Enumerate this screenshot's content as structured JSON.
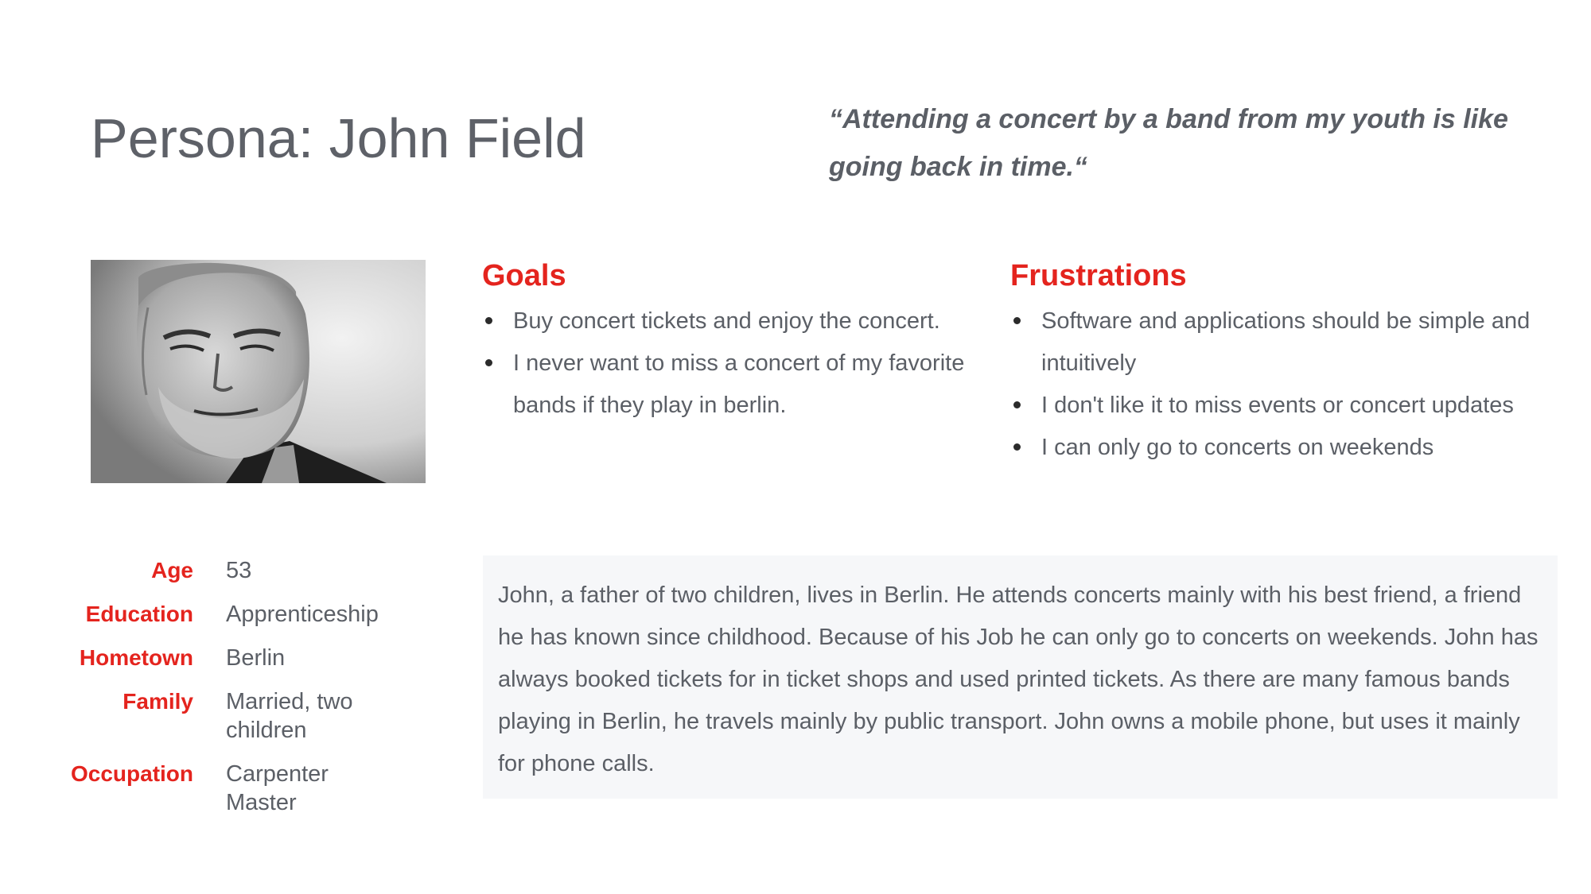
{
  "header": {
    "title": "Persona: John Field",
    "quote": "“Attending a concert by a band from my youth is like going back in time.“"
  },
  "portrait": {
    "icon": "person-portrait-photo"
  },
  "goals": {
    "heading": "Goals",
    "items": [
      "Buy concert tickets and enjoy the concert.",
      "I never want to miss a concert of my favorite bands if they play in berlin."
    ]
  },
  "frustrations": {
    "heading": "Frustrations",
    "items": [
      "Software and applications should be simple and intuitively",
      "I don't like it to miss events or concert updates",
      "I can only go to concerts on weekends"
    ]
  },
  "facts": [
    {
      "label": "Age",
      "value": "53"
    },
    {
      "label": "Education",
      "value": "Apprenticeship"
    },
    {
      "label": "Hometown",
      "value": "Berlin"
    },
    {
      "label": "Family",
      "value": "Married, two children"
    },
    {
      "label": "Occupation",
      "value": "Carpenter Master"
    }
  ],
  "bio": "John, a father of two children, lives in Berlin. He attends concerts mainly with his best friend, a friend he has known since childhood. Because of his Job he can only go to concerts on weekends. John has always booked tickets for in ticket shops and used printed tickets. As there are many famous bands playing in Berlin, he travels mainly by public transport. John owns a mobile phone, but uses it mainly for phone calls.",
  "colors": {
    "accent": "#e4241e",
    "text": "#5b5f66",
    "panel": "#f6f7f9"
  }
}
